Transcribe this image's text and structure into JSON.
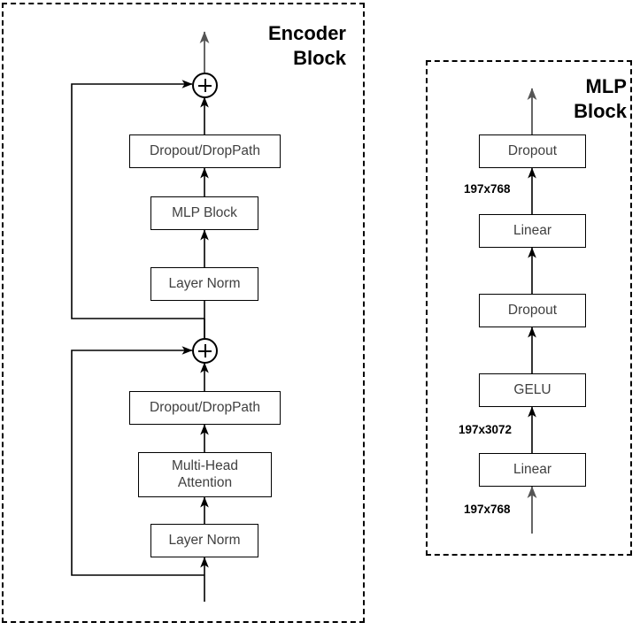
{
  "diagram": {
    "title_encoder": "Encoder\nBlock",
    "title_mlp": "MLP\nBlock"
  },
  "encoder_block": {
    "label": "Encoder\nBlock",
    "nodes": [
      {
        "id": "mlp-dropout-droppath",
        "label": "Dropout/DropPath"
      },
      {
        "id": "mlp-block",
        "label": "MLP Block"
      },
      {
        "id": "mlp-layer-norm",
        "label": "Layer Norm"
      },
      {
        "id": "attn-dropout-droppath",
        "label": "Dropout/DropPath"
      },
      {
        "id": "multi-head-attention",
        "label": "Multi-Head\nAttention"
      },
      {
        "id": "attn-layer-norm",
        "label": "Layer Norm"
      }
    ],
    "operators": [
      {
        "id": "residual-add-top",
        "label": "+"
      },
      {
        "id": "residual-add-bottom",
        "label": "+"
      }
    ]
  },
  "mlp_block": {
    "label": "MLP\nBlock",
    "nodes": [
      {
        "id": "mlp-dropout-out",
        "label": "Dropout"
      },
      {
        "id": "mlp-linear-out",
        "label": "Linear"
      },
      {
        "id": "mlp-dropout-mid",
        "label": "Dropout"
      },
      {
        "id": "mlp-gelu",
        "label": "GELU"
      },
      {
        "id": "mlp-linear-in",
        "label": "Linear"
      }
    ],
    "edge_labels": [
      {
        "id": "shape-out",
        "text": "197x768"
      },
      {
        "id": "shape-hidden",
        "text": "197x3072"
      },
      {
        "id": "shape-in",
        "text": "197x768"
      }
    ]
  },
  "colors": {
    "stroke": "#000000",
    "arrow_gray": "#555555",
    "text": "#404040",
    "background": "#ffffff"
  }
}
